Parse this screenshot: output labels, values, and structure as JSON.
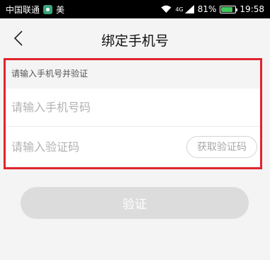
{
  "status_bar": {
    "carrier": "中国联通",
    "app_label": "美",
    "network_type": "4G",
    "battery_percent": "81%",
    "battery_level": 0.81,
    "time": "19:58",
    "icons": [
      "wifi-icon",
      "signal-icon",
      "battery-icon"
    ]
  },
  "header": {
    "back_icon": "chevron-left-icon",
    "title": "绑定手机号"
  },
  "form": {
    "section_hint": "请输入手机号并验证",
    "phone_placeholder": "请输入手机号码",
    "phone_value": "",
    "code_placeholder": "请输入验证码",
    "code_value": "",
    "get_code_label": "获取验证码"
  },
  "actions": {
    "verify_label": "验证"
  },
  "colors": {
    "highlight_border": "#e0242e",
    "disabled_button": "#dcdcdc",
    "background": "#f4f4f4"
  }
}
